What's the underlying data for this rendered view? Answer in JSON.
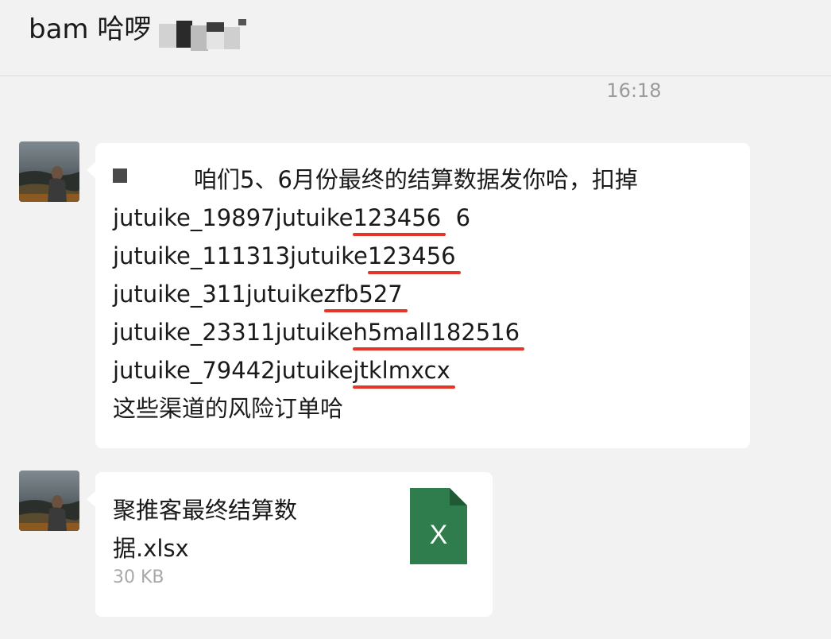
{
  "chat": {
    "title": "bam 哈啰"
  },
  "timestamp": "16:18",
  "message1": {
    "intro": "咱们5、6月份最终的结算数据发你哈，扣掉",
    "rows": [
      {
        "prefix": "jutuike_19897jutuike",
        "highlight": "123456",
        "suffix": "  6"
      },
      {
        "prefix": "jutuike_111313jutuike",
        "highlight": "123456",
        "suffix": ""
      },
      {
        "prefix": "jutuike_311jutuike",
        "highlight": "zfb527",
        "suffix": ""
      },
      {
        "prefix": "jutuike_23311jutuike",
        "highlight": "h5mall182516",
        "suffix": ""
      },
      {
        "prefix": "jutuike_79442jutuike",
        "highlight": "jtklmxcx",
        "suffix": ""
      }
    ],
    "outro": "这些渠道的风险订单哈",
    "highlight_color": "#e53528"
  },
  "file_message": {
    "file_name": "聚推客最终结算数据.xlsx",
    "file_size": "30 KB",
    "file_icon": "excel-file-icon",
    "icon_letter": "X",
    "icon_color": "#2f7d4c"
  }
}
